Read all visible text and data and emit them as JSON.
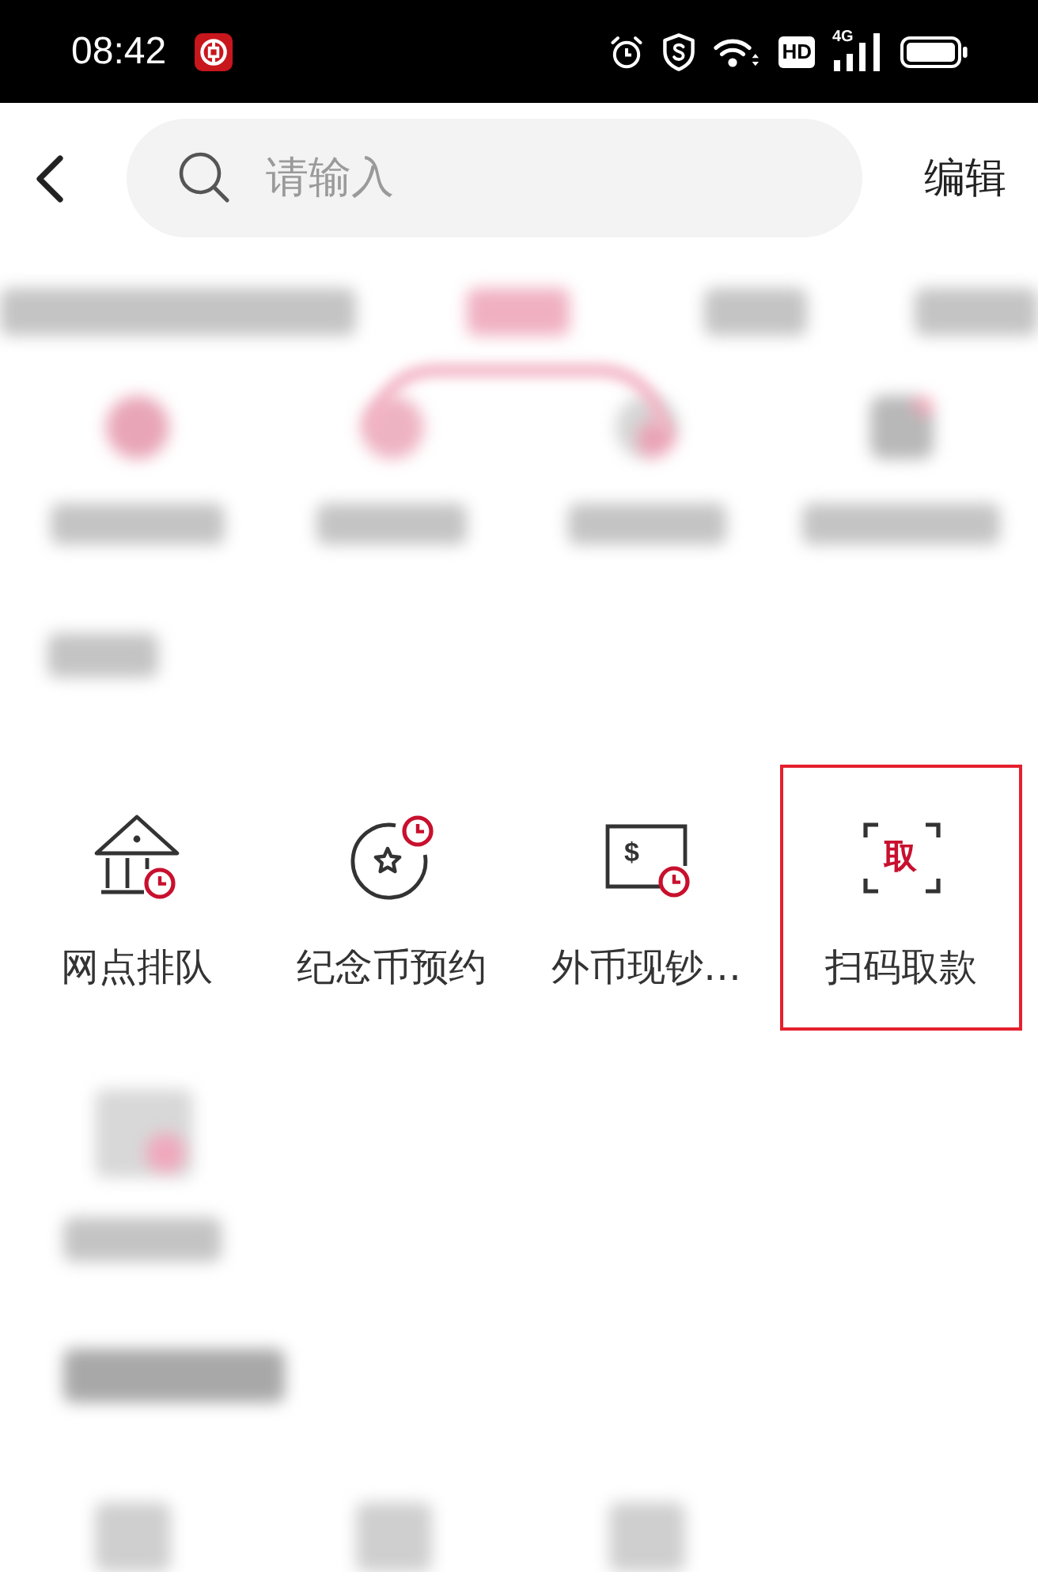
{
  "status_bar": {
    "time": "08:42",
    "hd_label": "HD",
    "network_label": "4G"
  },
  "header": {
    "search": {
      "placeholder": "请输入"
    },
    "edit": "编辑"
  },
  "services": [
    {
      "label": "网点排队",
      "highlighted": false
    },
    {
      "label": "纪念币预约",
      "highlighted": false
    },
    {
      "label": "外币现钞…",
      "icon_char": "$",
      "highlighted": false
    },
    {
      "label": "扫码取款",
      "icon_char": "取",
      "highlighted": true
    }
  ]
}
